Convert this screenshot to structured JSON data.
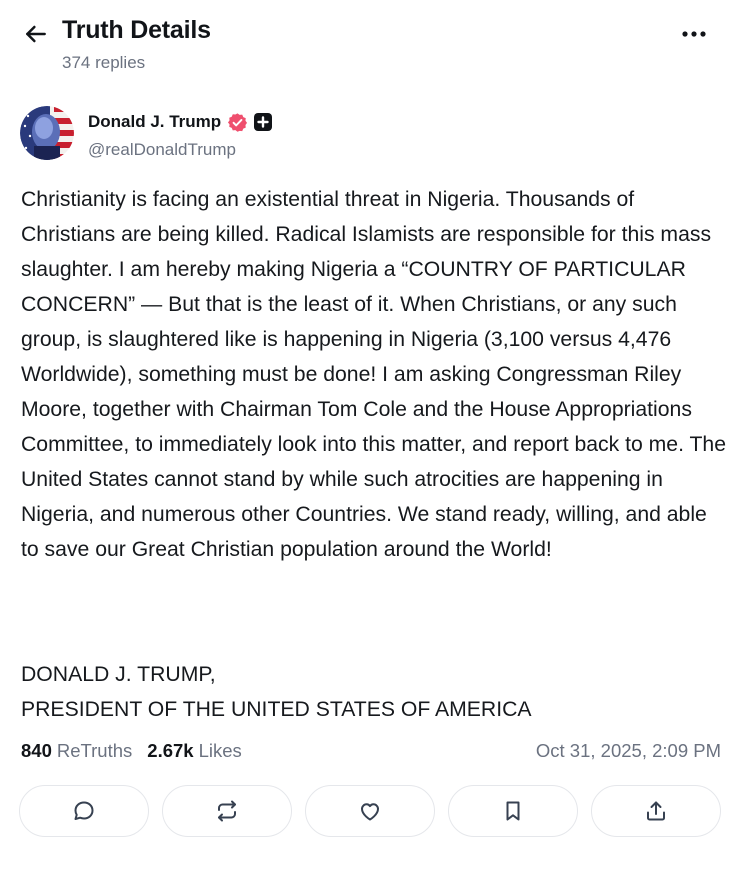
{
  "header": {
    "title": "Truth Details",
    "subtitle": "374 replies",
    "back_icon": "arrow-left-icon",
    "more_icon": "more-horizontal-icon"
  },
  "author": {
    "name": "Donald J. Trump",
    "handle": "@realDonaldTrump",
    "verified_color": "#ef4f6e",
    "badges": [
      "verified-badge-icon",
      "plus-badge-icon"
    ]
  },
  "post": {
    "body": "Christianity is facing an existential threat in Nigeria. Thousands of Christians are being killed. Radical Islamists are responsible for this mass slaughter. I am hereby making Nigeria a “COUNTRY OF PARTICULAR CONCERN” — But that is the least of it. When Christians, or any such group, is slaughtered like is happening in Nigeria (3,100 versus 4,476 Worldwide), something must be done! I am asking Congressman Riley Moore, together with Chairman Tom Cole and the House Appropriations Committee, to immediately look into this matter, and report back to me. The United States cannot stand by while such atrocities are happening in Nigeria, and numerous other Countries. We stand ready, willing, and able to save our Great Christian population around the World!",
    "signature_line1": "DONALD J. TRUMP,",
    "signature_line2": "PRESIDENT OF THE UNITED STATES OF AMERICA"
  },
  "stats": {
    "retruths_count": "840",
    "retruths_label": "ReTruths",
    "likes_count": "2.67k",
    "likes_label": "Likes",
    "timestamp": "Oct 31, 2025, 2:09 PM"
  },
  "actions": [
    {
      "name": "reply",
      "icon": "comment-icon"
    },
    {
      "name": "retruth",
      "icon": "repost-icon"
    },
    {
      "name": "like",
      "icon": "heart-icon"
    },
    {
      "name": "bookmark",
      "icon": "bookmark-icon"
    },
    {
      "name": "share",
      "icon": "share-icon"
    }
  ]
}
